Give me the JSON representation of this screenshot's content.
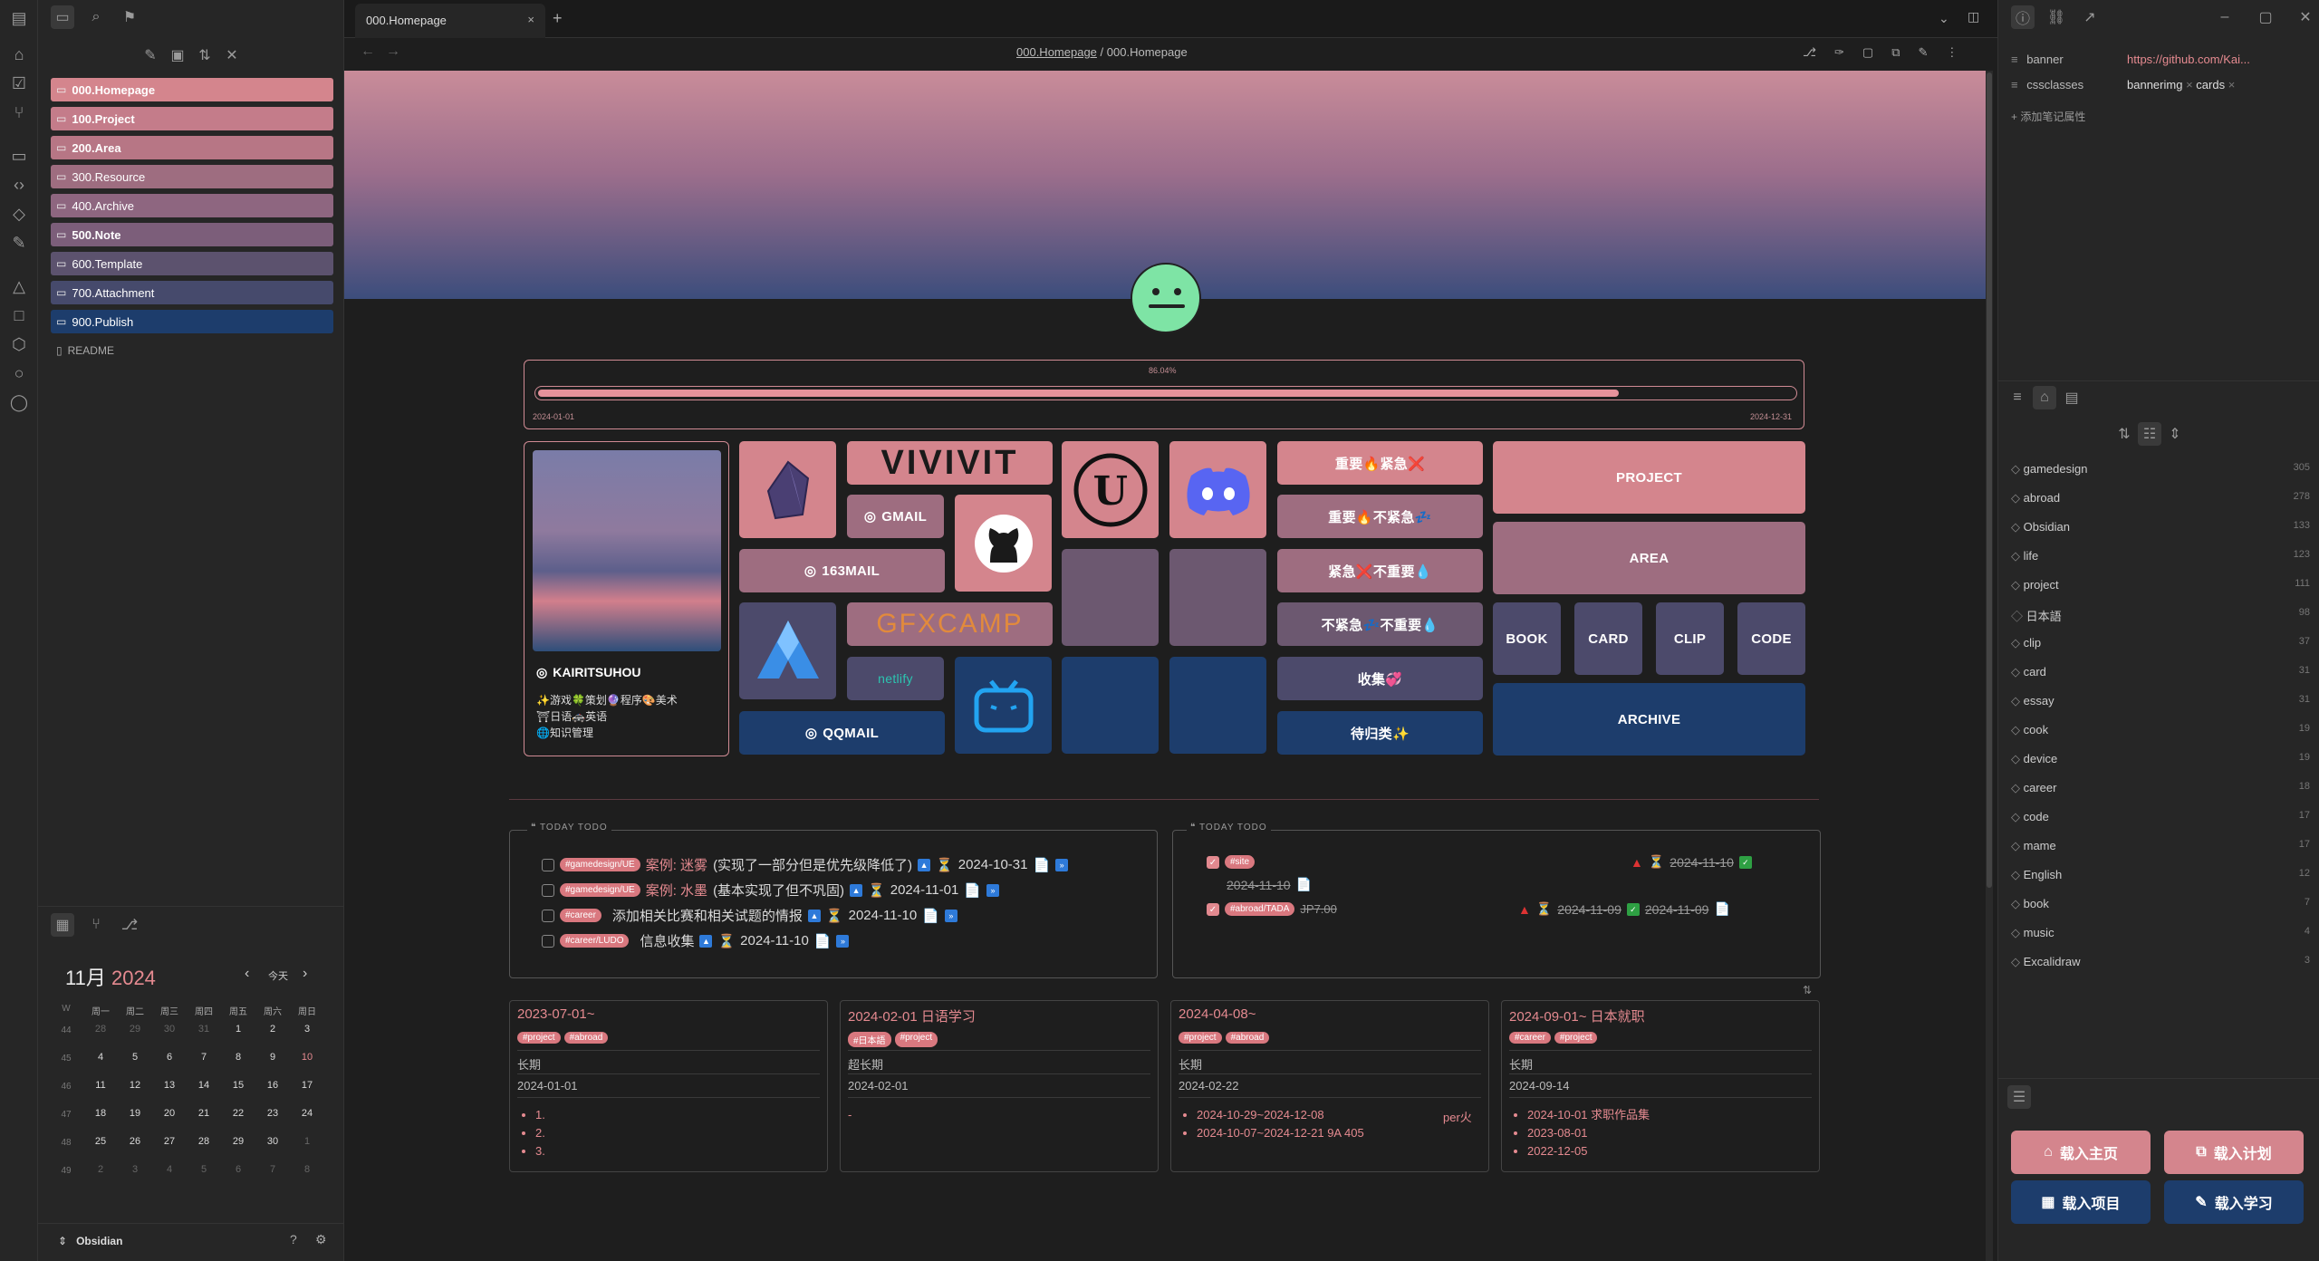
{
  "colors": {
    "accent": "#e58a90",
    "pink": "#d4858d",
    "navy": "#1d3d6c"
  },
  "tab": {
    "title": "000.Homepage",
    "close": "×",
    "add": "+"
  },
  "breadcrumb": {
    "parent": "000.Homepage",
    "sep": "/",
    "current": "000.Homepage"
  },
  "folders": [
    {
      "name": "000.Homepage",
      "bold": true
    },
    {
      "name": "100.Project",
      "bold": true
    },
    {
      "name": "200.Area",
      "bold": true
    },
    {
      "name": "300.Resource",
      "bold": false
    },
    {
      "name": "400.Archive",
      "bold": false
    },
    {
      "name": "500.Note",
      "bold": true
    },
    {
      "name": "600.Template",
      "bold": false
    },
    {
      "name": "700.Attachment",
      "bold": false
    },
    {
      "name": "900.Publish",
      "bold": false
    }
  ],
  "readme": "README",
  "calendar": {
    "month": "11月",
    "year": "2024",
    "today": "今天",
    "weekhead": [
      "W",
      "周一",
      "周二",
      "周三",
      "周四",
      "周五",
      "周六",
      "周日"
    ],
    "weeks": [
      {
        "w": "44",
        "d": [
          "28",
          "29",
          "30",
          "31",
          "1",
          "2",
          "3"
        ]
      },
      {
        "w": "45",
        "d": [
          "4",
          "5",
          "6",
          "7",
          "8",
          "9",
          "10"
        ]
      },
      {
        "w": "46",
        "d": [
          "11",
          "12",
          "13",
          "14",
          "15",
          "16",
          "17"
        ]
      },
      {
        "w": "47",
        "d": [
          "18",
          "19",
          "20",
          "21",
          "22",
          "23",
          "24"
        ]
      },
      {
        "w": "48",
        "d": [
          "25",
          "26",
          "27",
          "28",
          "29",
          "30",
          "1"
        ]
      },
      {
        "w": "49",
        "d": [
          "2",
          "3",
          "4",
          "5",
          "6",
          "7",
          "8"
        ]
      }
    ]
  },
  "vault": {
    "name": "Obsidian"
  },
  "progress": {
    "percent_label": "86.04%",
    "fraction": 0.8604,
    "start": "2024-01-01",
    "end": "2024-12-31"
  },
  "profile": {
    "name": "KAIRITSUHOU",
    "line1": "✨游戏🍀策划🔮程序🎨美术",
    "line2": "⛩日语🚓英语",
    "line3": "🌐知识管理"
  },
  "tiles": {
    "vivivit": "VIVIVIT",
    "gmail": "GMAIL",
    "mail163": "163MAIL",
    "gfxcamp": "GFXCAMP",
    "netlify": "netlify",
    "qqmail": "QQMAIL",
    "t1": "重要🔥紧急❌",
    "t2": "重要🔥不紧急💤",
    "t3": "紧急❌不重要💧",
    "t4": "不紧急💤不重要💧",
    "t5": "收集💞",
    "t6": "待归类✨",
    "project": "PROJECT",
    "area": "AREA",
    "book": "BOOK",
    "card": "CARD",
    "clip": "CLIP",
    "code": "CODE",
    "archive": "ARCHIVE"
  },
  "todo_left": {
    "title": "TODAY TODO",
    "rows": [
      {
        "tag": "#gamedesign/UE",
        "pre": "案例: 迷雾",
        "text": "(实现了一部分但是优先级降低了)",
        "date": "2024-10-31"
      },
      {
        "tag": "#gamedesign/UE",
        "pre": "案例: 水墨",
        "text": "(基本实现了但不巩固)",
        "date": "2024-11-01"
      },
      {
        "tag": "#career",
        "pre": "",
        "text": "添加相关比赛和相关试题的情报",
        "date": "2024-11-10"
      },
      {
        "tag": "#career/LUDO",
        "pre": "",
        "text": "信息收集",
        "date": "2024-11-10"
      }
    ]
  },
  "todo_right": {
    "title": "TODAY TODO",
    "rows": [
      {
        "tag": "#site",
        "date1": "2024-11-10",
        "date2": "2024-11-10"
      },
      {
        "tag": "#abroad/TADA",
        "extra": "JP7.00",
        "date1": "2024-11-09",
        "date2": "2024-11-09"
      }
    ]
  },
  "cards": [
    {
      "title": "2023-07-01~",
      "tags": [
        "#project",
        "#abroad"
      ],
      "term": "长期",
      "date": "2024-01-01",
      "items": [
        "1.",
        "2.",
        "3."
      ],
      "note": ""
    },
    {
      "title": "2024-02-01 日语学习",
      "tags": [
        "#日本語",
        "#project"
      ],
      "term": "超长期",
      "date": "2024-02-01",
      "items": [],
      "note": "-"
    },
    {
      "title": "2024-04-08~",
      "tags": [
        "#project",
        "#abroad"
      ],
      "term": "长期",
      "date": "2024-02-22",
      "items": [
        "2024-10-29~2024-12-08",
        "2024-10-07~2024-12-21 9A 405"
      ],
      "note": "per火"
    },
    {
      "title": "2024-09-01~ 日本就职",
      "tags": [
        "#career",
        "#project"
      ],
      "term": "长期",
      "date": "2024-09-14",
      "items": [
        "2024-10-01 求职作品集",
        "2023-08-01",
        "2022-12-05"
      ],
      "note": ""
    }
  ],
  "properties": [
    {
      "key": "banner",
      "value": "https://github.com/Kai..."
    },
    {
      "key": "cssclasses",
      "value": "bannerimg",
      "value2": "cards"
    }
  ],
  "add_property": "添加笔记属性",
  "tags": [
    {
      "name": "gamedesign",
      "count": "305"
    },
    {
      "name": "abroad",
      "count": "278"
    },
    {
      "name": "Obsidian",
      "count": "133"
    },
    {
      "name": "life",
      "count": "123"
    },
    {
      "name": "project",
      "count": "111"
    },
    {
      "name": "日本語",
      "count": "98"
    },
    {
      "name": "clip",
      "count": "37"
    },
    {
      "name": "card",
      "count": "31"
    },
    {
      "name": "essay",
      "count": "31"
    },
    {
      "name": "cook",
      "count": "19"
    },
    {
      "name": "device",
      "count": "19"
    },
    {
      "name": "career",
      "count": "18"
    },
    {
      "name": "code",
      "count": "17"
    },
    {
      "name": "mame",
      "count": "17"
    },
    {
      "name": "English",
      "count": "12"
    },
    {
      "name": "book",
      "count": "7"
    },
    {
      "name": "music",
      "count": "4"
    },
    {
      "name": "Excalidraw",
      "count": "3"
    }
  ],
  "buttons": {
    "home": "载入主页",
    "plan": "载入计划",
    "project": "载入项目",
    "study": "载入学习"
  }
}
